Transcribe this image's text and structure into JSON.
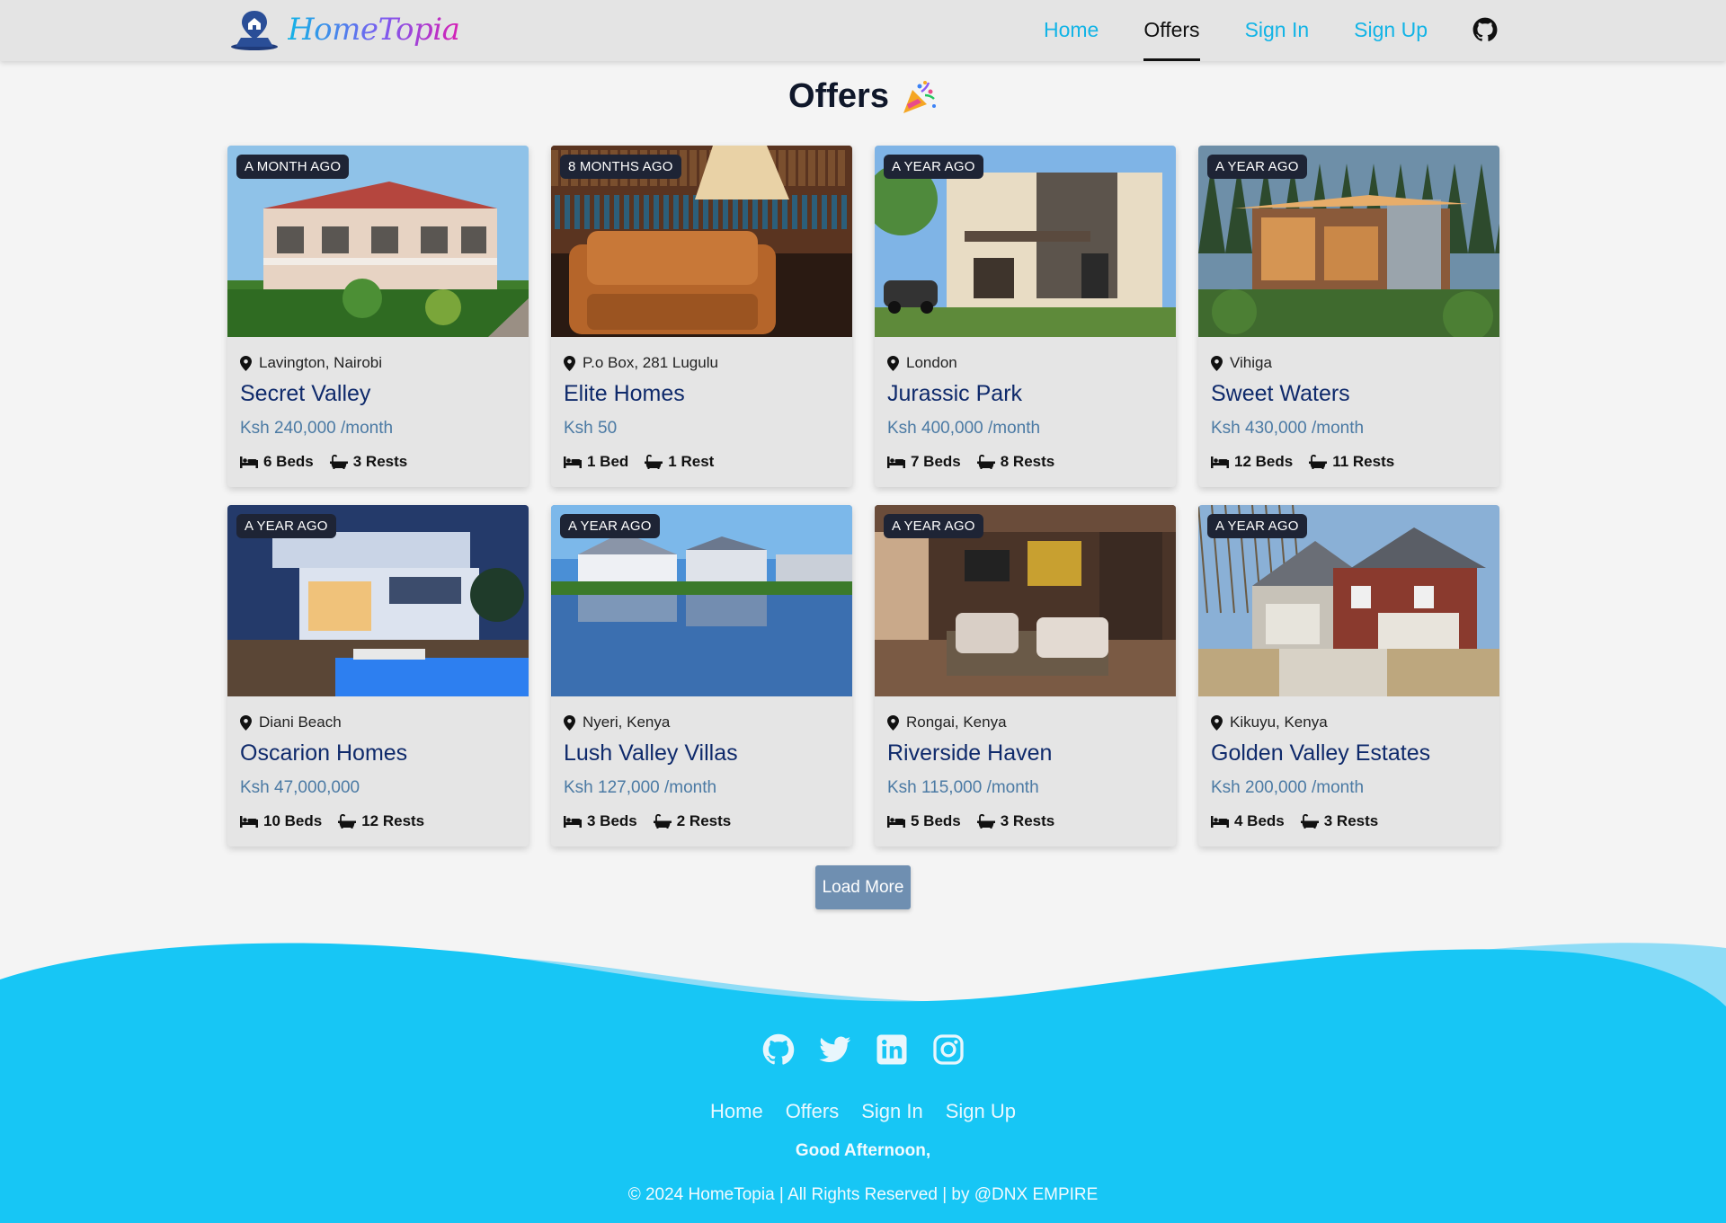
{
  "header": {
    "logo_text": "HomeTopia",
    "nav": {
      "home": "Home",
      "offers": "Offers",
      "sign_in": "Sign In",
      "sign_up": "Sign Up"
    },
    "github_icon": "github-icon"
  },
  "page": {
    "title": "Offers",
    "title_icon": "party-popper-icon"
  },
  "listings": [
    {
      "badge": "A MONTH AGO",
      "location": "Lavington, Nairobi",
      "name": "Secret Valley",
      "price": "Ksh 240,000 /month",
      "beds": "6 Beds",
      "baths": "3 Rests",
      "scene": "villa"
    },
    {
      "badge": "8 MONTHS AGO",
      "location": "P.o Box, 281 Lugulu",
      "name": "Elite Homes",
      "price": "Ksh 50",
      "beds": "1 Bed",
      "baths": "1 Rest",
      "scene": "library"
    },
    {
      "badge": "A YEAR AGO",
      "location": "London",
      "name": "Jurassic Park",
      "price": "Ksh 400,000 /month",
      "beds": "7 Beds",
      "baths": "8 Rests",
      "scene": "modern-house"
    },
    {
      "badge": "A YEAR AGO",
      "location": "Vihiga",
      "name": "Sweet Waters",
      "price": "Ksh 430,000 /month",
      "beds": "12 Beds",
      "baths": "11 Rests",
      "scene": "forest-house"
    },
    {
      "badge": "A YEAR AGO",
      "location": "Diani Beach",
      "name": "Oscarion Homes",
      "price": "Ksh 47,000,000",
      "beds": "10 Beds",
      "baths": "12 Rests",
      "scene": "pool-villa"
    },
    {
      "badge": "A YEAR AGO",
      "location": "Nyeri, Kenya",
      "name": "Lush Valley Villas",
      "price": "Ksh 127,000 /month",
      "beds": "3 Beds",
      "baths": "2 Rests",
      "scene": "lake-houses"
    },
    {
      "badge": "A YEAR AGO",
      "location": "Rongai, Kenya",
      "name": "Riverside Haven",
      "price": "Ksh 115,000 /month",
      "beds": "5 Beds",
      "baths": "3 Rests",
      "scene": "living-room"
    },
    {
      "badge": "A YEAR AGO",
      "location": "Kikuyu, Kenya",
      "name": "Golden Valley Estates",
      "price": "Ksh 200,000 /month",
      "beds": "4 Beds",
      "baths": "3 Rests",
      "scene": "brick-house"
    }
  ],
  "load_more": "Load More",
  "footer": {
    "social_icons": [
      "github-icon",
      "twitter-icon",
      "linkedin-icon",
      "instagram-icon"
    ],
    "nav": {
      "home": "Home",
      "offers": "Offers",
      "sign_in": "Sign In",
      "sign_up": "Sign Up"
    },
    "greeting": "Good Afternoon,",
    "copyright": "© 2024 HomeTopia | All Rights Reserved | by @DNX EMPIRE"
  },
  "colors": {
    "accent": "#12b4e6",
    "footer_bg": "#17c6f5",
    "badge_bg": "#1e2435",
    "title_blue": "#0f2a6b",
    "price_blue": "#4b7aa4",
    "button_bg": "#6f8fb1"
  }
}
